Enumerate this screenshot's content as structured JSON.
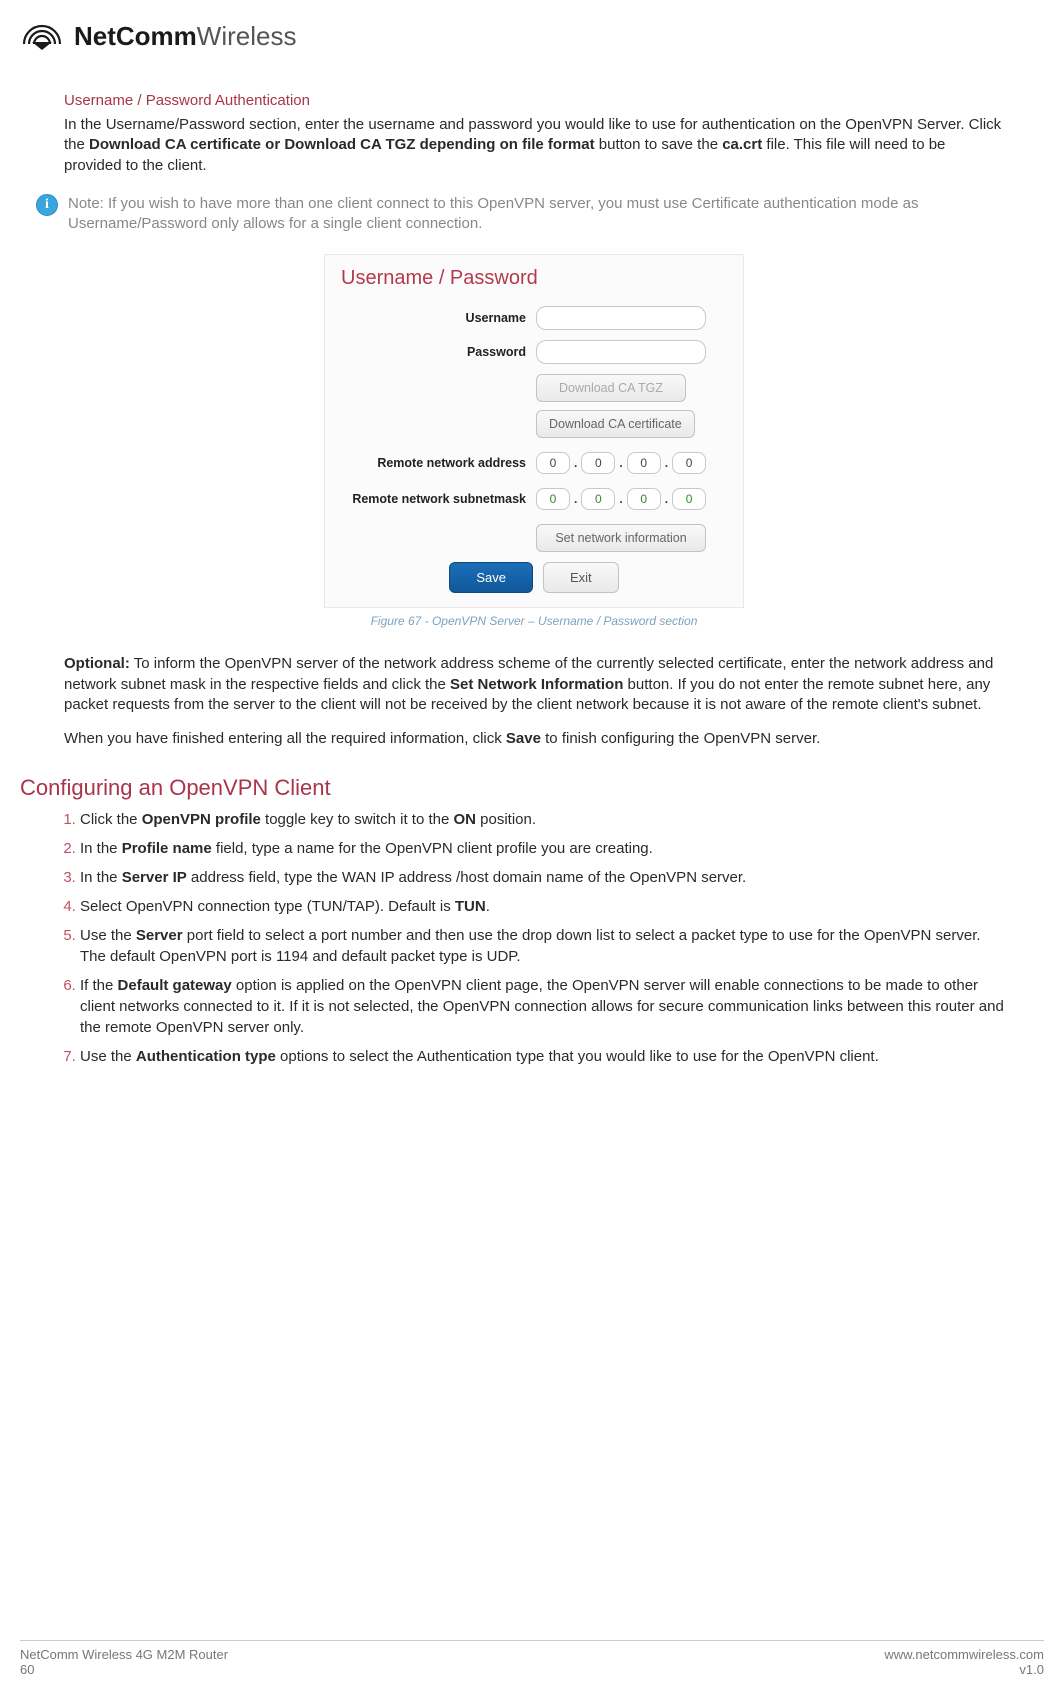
{
  "header": {
    "brand_bold": "NetComm",
    "brand_light": "Wireless"
  },
  "section1": {
    "heading": "Username / Password Authentication",
    "para1_pre": "In the Username/Password section, enter the username and password you would like to use for authentication on the OpenVPN Server. Click the ",
    "para1_bold1": "Download CA certificate or Download CA TGZ depending on file format",
    "para1_mid": " button to save the ",
    "para1_bold2": "ca.crt",
    "para1_post": " file. This file will need to be provided to the client.",
    "note": "Note: If you wish to have more than one client connect to this OpenVPN server, you must use Certificate authentication mode as Username/Password only allows for a single client connection."
  },
  "screenshot": {
    "title": "Username / Password",
    "username_label": "Username",
    "password_label": "Password",
    "btn_download_tgz": "Download CA TGZ",
    "btn_download_cert": "Download CA certificate",
    "remote_addr_label": "Remote network address",
    "remote_mask_label": "Remote network subnetmask",
    "ip_addr": [
      "0",
      "0",
      "0",
      "0"
    ],
    "ip_mask": [
      "0",
      "0",
      "0",
      "0"
    ],
    "btn_set_network": "Set network information",
    "btn_save": "Save",
    "btn_exit": "Exit",
    "caption": "Figure 67 - OpenVPN Server – Username / Password section"
  },
  "section1b": {
    "optional_b": "Optional:",
    "optional_txt1": " To inform the OpenVPN server of the network address scheme of the currently selected certificate, enter the network address and network subnet mask in the respective fields and click the ",
    "optional_b2": "Set Network Information",
    "optional_txt2": " button. If you do not enter the remote subnet here, any packet requests from the server to the client will not be received by the client network because it is not aware of the remote client's subnet.",
    "finish_pre": "When you have finished entering all the required information, click ",
    "finish_b": "Save",
    "finish_post": " to finish configuring the OpenVPN server."
  },
  "section2": {
    "heading": "Configuring an OpenVPN Client",
    "steps": [
      {
        "pre": "Click the ",
        "b": "OpenVPN profile",
        "mid": " toggle key to switch it to the ",
        "b2": "ON",
        "post": " position."
      },
      {
        "pre": "In the ",
        "b": "Profile name",
        "post": " field, type a name for the OpenVPN client profile you are creating."
      },
      {
        "pre": "In the ",
        "b": "Server IP",
        "post": " address field, type the WAN IP address /host domain name of the OpenVPN server."
      },
      {
        "pre": "Select OpenVPN connection type (TUN/TAP). Default is ",
        "b": "TUN",
        "post": "."
      },
      {
        "pre": "Use the ",
        "b": "Server",
        "post": " port field to select a port number and then use the drop down list to select a packet type to use for the OpenVPN server. The default OpenVPN port is 1194 and default packet type is UDP."
      },
      {
        "pre": "If the ",
        "b": "Default gateway",
        "post": " option is applied on the OpenVPN client page, the OpenVPN server will enable connections to be made to other client networks connected to it. If it is not selected, the OpenVPN connection allows for secure communication links between this router and the remote OpenVPN server only."
      },
      {
        "pre": "Use the ",
        "b": "Authentication type",
        "post": " options to select the Authentication type that you would like to use for the OpenVPN client."
      }
    ]
  },
  "footer": {
    "product": "NetComm Wireless 4G M2M Router",
    "page": "60",
    "url": "www.netcommwireless.com",
    "version": "v1.0"
  }
}
